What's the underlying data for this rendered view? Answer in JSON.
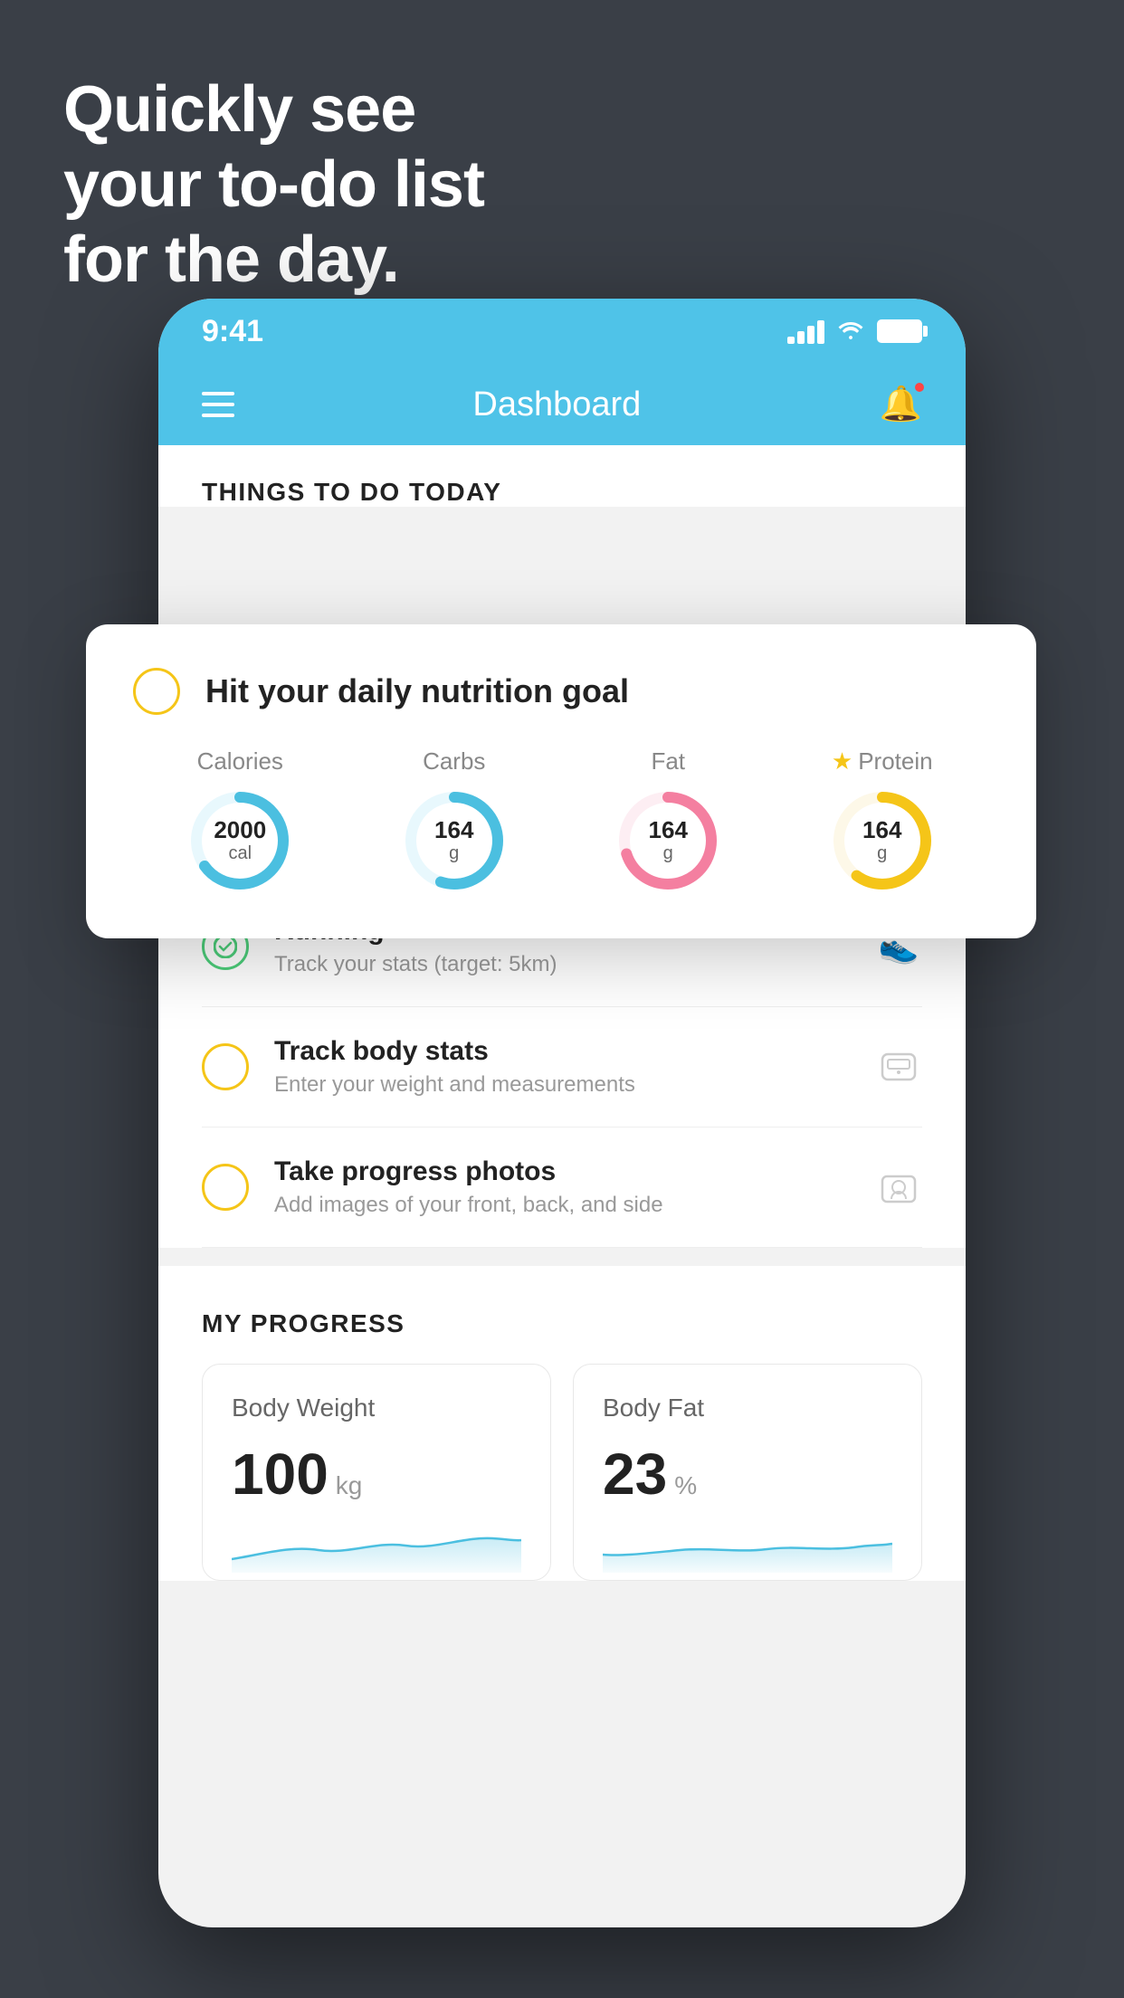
{
  "hero": {
    "line1": "Quickly see",
    "line2": "your to-do list",
    "line3": "for the day."
  },
  "phone": {
    "status": {
      "time": "9:41",
      "signal_bars": [
        8,
        14,
        20,
        26
      ],
      "wifi": "wifi",
      "battery": "battery"
    },
    "header": {
      "title": "Dashboard",
      "menu_label": "menu",
      "bell_label": "notifications"
    },
    "things_section": {
      "title": "THINGS TO DO TODAY"
    },
    "floating_card": {
      "title": "Hit your daily nutrition goal",
      "nutrients": [
        {
          "label": "Calories",
          "value": "2000",
          "unit": "cal",
          "color": "#4bbfe0",
          "track_color": "#e8f8fd",
          "progress": 0.65
        },
        {
          "label": "Carbs",
          "value": "164",
          "unit": "g",
          "color": "#4bbfe0",
          "track_color": "#e8f8fd",
          "progress": 0.55
        },
        {
          "label": "Fat",
          "value": "164",
          "unit": "g",
          "color": "#f47fa0",
          "track_color": "#fdeef3",
          "progress": 0.7
        },
        {
          "label": "Protein",
          "value": "164",
          "unit": "g",
          "color": "#f5c518",
          "track_color": "#fdf8e8",
          "progress": 0.6,
          "starred": true
        }
      ]
    },
    "todo_items": [
      {
        "title": "Running",
        "subtitle": "Track your stats (target: 5km)",
        "icon": "shoe",
        "checked": true,
        "check_color": "#4cce7a"
      },
      {
        "title": "Track body stats",
        "subtitle": "Enter your weight and measurements",
        "icon": "scale",
        "checked": false,
        "check_color": "#f5c518"
      },
      {
        "title": "Take progress photos",
        "subtitle": "Add images of your front, back, and side",
        "icon": "photo",
        "checked": false,
        "check_color": "#f5c518"
      }
    ],
    "progress_section": {
      "title": "MY PROGRESS",
      "cards": [
        {
          "title": "Body Weight",
          "value": "100",
          "unit": "kg"
        },
        {
          "title": "Body Fat",
          "value": "23",
          "unit": "%"
        }
      ]
    }
  },
  "colors": {
    "blue": "#4fc3e8",
    "yellow": "#f5c518",
    "green": "#4cce7a",
    "pink": "#f47fa0",
    "dark_bg": "#3a3f47"
  }
}
